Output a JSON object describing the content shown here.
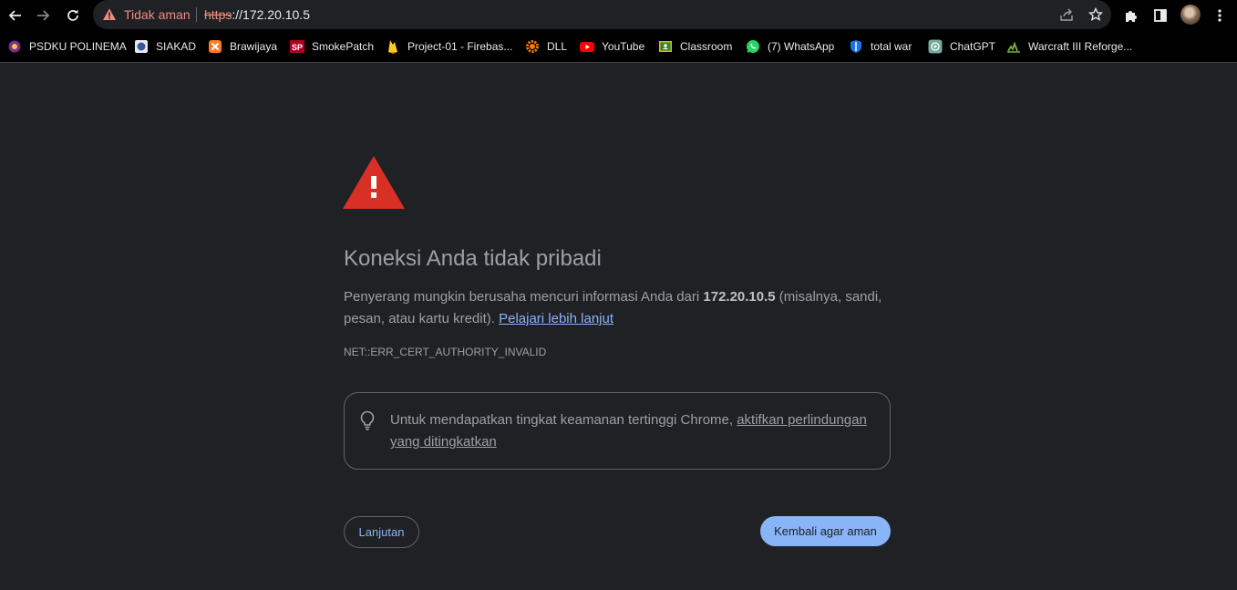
{
  "toolbar": {
    "security_label": "Tidak aman",
    "url_scheme": "https",
    "url_rest": "://172.20.10.5"
  },
  "bookmarks": [
    {
      "label": "PSDKU POLINEMA",
      "icon": "polinema-logo-icon"
    },
    {
      "label": "SIAKAD",
      "icon": "siakad-logo-icon"
    },
    {
      "label": "Brawijaya",
      "icon": "xampp-logo-icon"
    },
    {
      "label": "SmokePatch",
      "icon": "smokepatch-logo-icon",
      "badge": "SP"
    },
    {
      "label": "Project-01 - Firebas...",
      "icon": "firebase-logo-icon"
    },
    {
      "label": "DLL",
      "icon": "gear-orange-icon"
    },
    {
      "label": "YouTube",
      "icon": "youtube-logo-icon"
    },
    {
      "label": "Classroom",
      "icon": "classroom-logo-icon"
    },
    {
      "label": "(7) WhatsApp",
      "icon": "whatsapp-logo-icon"
    },
    {
      "label": "total war",
      "icon": "shield-logo-icon"
    },
    {
      "label": "ChatGPT",
      "icon": "chatgpt-logo-icon"
    },
    {
      "label": "Warcraft III Reforge...",
      "icon": "warcraft-logo-icon"
    }
  ],
  "interstitial": {
    "heading": "Koneksi Anda tidak pribadi",
    "explanation_pre": "Penyerang mungkin berusaha mencuri informasi Anda dari ",
    "explanation_host": "172.20.10.5",
    "explanation_post": " (misalnya, sandi, pesan, atau kartu kredit). ",
    "learn_more": "Pelajari lebih lanjut",
    "error_code": "NET::ERR_CERT_AUTHORITY_INVALID",
    "enhanced_text": "Untuk mendapatkan tingkat keamanan tertinggi Chrome, ",
    "enhanced_link": "aktifkan perlindungan yang ditingkatkan",
    "advanced_button": "Lanjutan",
    "back_button": "Kembali agar aman"
  },
  "colors": {
    "background": "#202124",
    "warning_red": "#d93025",
    "link_blue": "#8ab4f8",
    "insecure_red": "#f28b82"
  }
}
